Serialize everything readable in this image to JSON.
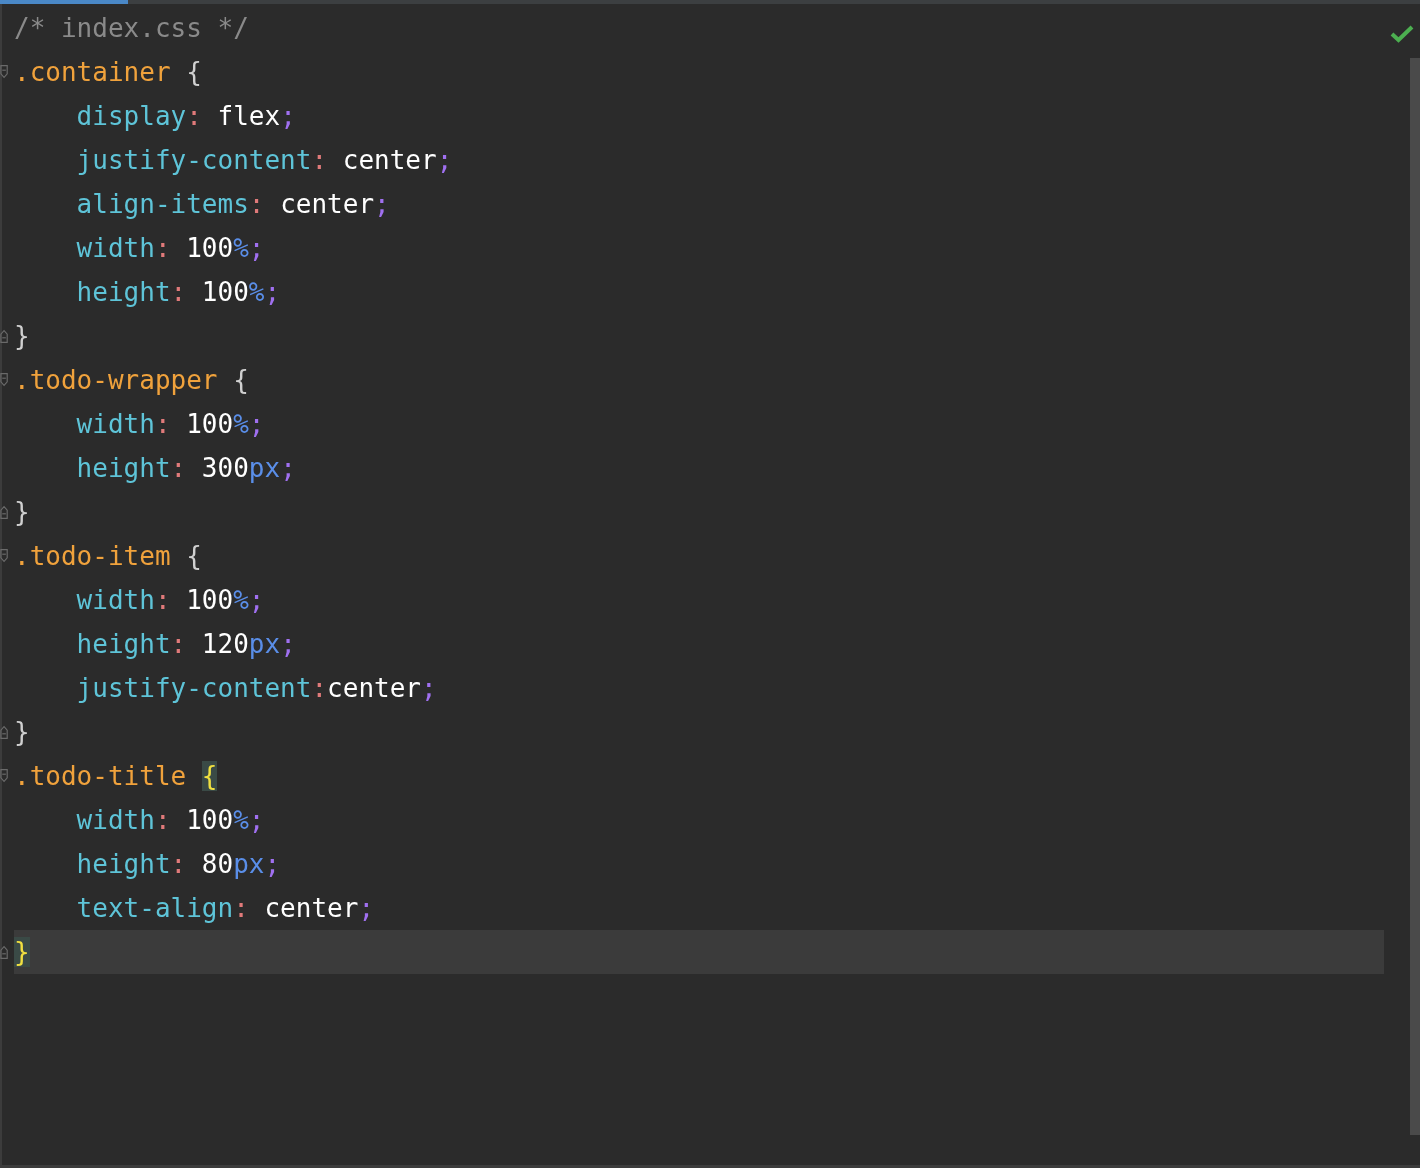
{
  "editor": {
    "lines": [
      {
        "kind": "comment",
        "current": false,
        "tokens": [
          {
            "kind": "comment",
            "text": "/* index.css */"
          }
        ]
      },
      {
        "kind": "block-start",
        "current": false,
        "tokens": [
          {
            "kind": "selector",
            "text": ".container"
          },
          {
            "kind": "brace",
            "text": " {"
          }
        ]
      },
      {
        "kind": "declaration",
        "current": false,
        "tokens": [
          {
            "kind": "property",
            "text": "    display"
          },
          {
            "kind": "colon",
            "text": ": "
          },
          {
            "kind": "value",
            "text": "flex"
          },
          {
            "kind": "semicolon",
            "text": ";"
          }
        ]
      },
      {
        "kind": "declaration",
        "current": false,
        "tokens": [
          {
            "kind": "property",
            "text": "    justify-content"
          },
          {
            "kind": "colon",
            "text": ": "
          },
          {
            "kind": "value",
            "text": "center"
          },
          {
            "kind": "semicolon",
            "text": ";"
          }
        ]
      },
      {
        "kind": "declaration",
        "current": false,
        "tokens": [
          {
            "kind": "property",
            "text": "    align-items"
          },
          {
            "kind": "colon",
            "text": ": "
          },
          {
            "kind": "value",
            "text": "center"
          },
          {
            "kind": "semicolon",
            "text": ";"
          }
        ]
      },
      {
        "kind": "declaration",
        "current": false,
        "tokens": [
          {
            "kind": "property",
            "text": "    width"
          },
          {
            "kind": "colon",
            "text": ": "
          },
          {
            "kind": "value",
            "text": "100"
          },
          {
            "kind": "unit",
            "text": "%"
          },
          {
            "kind": "semicolon",
            "text": ";"
          }
        ]
      },
      {
        "kind": "declaration",
        "current": false,
        "tokens": [
          {
            "kind": "property",
            "text": "    height"
          },
          {
            "kind": "colon",
            "text": ": "
          },
          {
            "kind": "value",
            "text": "100"
          },
          {
            "kind": "unit",
            "text": "%"
          },
          {
            "kind": "semicolon",
            "text": ";"
          }
        ]
      },
      {
        "kind": "block-end",
        "current": false,
        "tokens": [
          {
            "kind": "brace",
            "text": "}"
          }
        ]
      },
      {
        "kind": "block-start",
        "current": false,
        "tokens": [
          {
            "kind": "selector",
            "text": ".todo-wrapper"
          },
          {
            "kind": "brace",
            "text": " {"
          }
        ]
      },
      {
        "kind": "declaration",
        "current": false,
        "tokens": [
          {
            "kind": "property",
            "text": "    width"
          },
          {
            "kind": "colon",
            "text": ": "
          },
          {
            "kind": "value",
            "text": "100"
          },
          {
            "kind": "unit",
            "text": "%"
          },
          {
            "kind": "semicolon",
            "text": ";"
          }
        ]
      },
      {
        "kind": "declaration",
        "current": false,
        "tokens": [
          {
            "kind": "property",
            "text": "    height"
          },
          {
            "kind": "colon",
            "text": ": "
          },
          {
            "kind": "value",
            "text": "300"
          },
          {
            "kind": "unit",
            "text": "px"
          },
          {
            "kind": "semicolon",
            "text": ";"
          }
        ]
      },
      {
        "kind": "block-end",
        "current": false,
        "tokens": [
          {
            "kind": "brace",
            "text": "}"
          }
        ]
      },
      {
        "kind": "block-start",
        "current": false,
        "tokens": [
          {
            "kind": "selector",
            "text": ".todo-item"
          },
          {
            "kind": "brace",
            "text": " {"
          }
        ]
      },
      {
        "kind": "declaration",
        "current": false,
        "tokens": [
          {
            "kind": "property",
            "text": "    width"
          },
          {
            "kind": "colon",
            "text": ": "
          },
          {
            "kind": "value",
            "text": "100"
          },
          {
            "kind": "unit",
            "text": "%"
          },
          {
            "kind": "semicolon",
            "text": ";"
          }
        ]
      },
      {
        "kind": "declaration",
        "current": false,
        "tokens": [
          {
            "kind": "property",
            "text": "    height"
          },
          {
            "kind": "colon",
            "text": ": "
          },
          {
            "kind": "value",
            "text": "120"
          },
          {
            "kind": "unit",
            "text": "px"
          },
          {
            "kind": "semicolon",
            "text": ";"
          }
        ]
      },
      {
        "kind": "declaration",
        "current": false,
        "tokens": [
          {
            "kind": "property",
            "text": "    justify-content"
          },
          {
            "kind": "colon",
            "text": ":"
          },
          {
            "kind": "value",
            "text": "center"
          },
          {
            "kind": "semicolon",
            "text": ";"
          }
        ]
      },
      {
        "kind": "block-end",
        "current": false,
        "tokens": [
          {
            "kind": "brace",
            "text": "}"
          }
        ]
      },
      {
        "kind": "block-start",
        "current": false,
        "tokens": [
          {
            "kind": "selector",
            "text": ".todo-title"
          },
          {
            "kind": "brace-match",
            "text": "{"
          }
        ]
      },
      {
        "kind": "declaration",
        "current": false,
        "tokens": [
          {
            "kind": "property",
            "text": "    width"
          },
          {
            "kind": "colon",
            "text": ": "
          },
          {
            "kind": "value",
            "text": "100"
          },
          {
            "kind": "unit",
            "text": "%"
          },
          {
            "kind": "semicolon",
            "text": ";"
          }
        ]
      },
      {
        "kind": "declaration",
        "current": false,
        "tokens": [
          {
            "kind": "property",
            "text": "    height"
          },
          {
            "kind": "colon",
            "text": ": "
          },
          {
            "kind": "value",
            "text": "80"
          },
          {
            "kind": "unit",
            "text": "px"
          },
          {
            "kind": "semicolon",
            "text": ";"
          }
        ]
      },
      {
        "kind": "declaration",
        "current": false,
        "tokens": [
          {
            "kind": "property",
            "text": "    text-align"
          },
          {
            "kind": "colon",
            "text": ": "
          },
          {
            "kind": "value",
            "text": "center"
          },
          {
            "kind": "semicolon",
            "text": ";"
          }
        ]
      },
      {
        "kind": "block-end",
        "current": true,
        "tokens": [
          {
            "kind": "brace-match",
            "text": "}"
          }
        ]
      }
    ]
  }
}
